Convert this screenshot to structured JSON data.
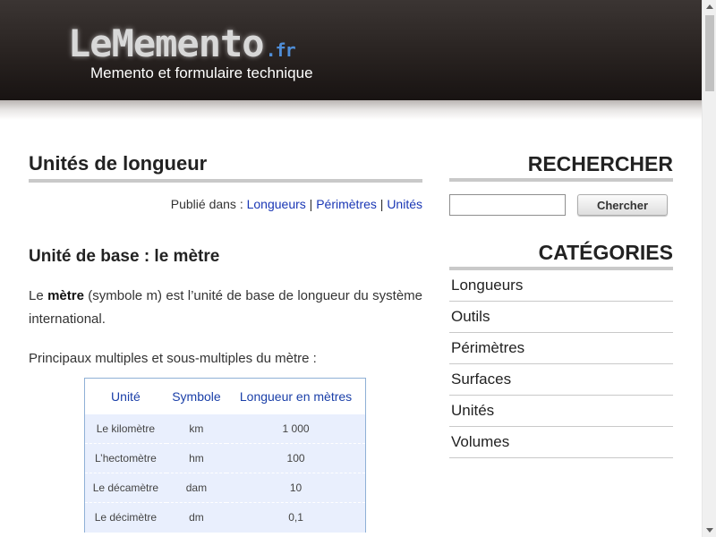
{
  "header": {
    "logo_main": "LeMemento",
    "logo_tld": ".fr",
    "tagline": "Memento et formulaire technique"
  },
  "article": {
    "title": "Unités de longueur",
    "published_prefix": "Publié dans :",
    "published_links": [
      "Longueurs",
      "Périmètres",
      "Unités"
    ],
    "section_title": "Unité de base : le mètre",
    "para1_before": "Le ",
    "para1_bold": "mètre",
    "para1_after": " (symbole m) est l’unité de base de longueur du système international.",
    "para2": "Principaux multiples et sous-multiples du mètre :",
    "table": {
      "headers": [
        "Unité",
        "Symbole",
        "Longueur en mètres"
      ],
      "rows": [
        [
          "Le kilomètre",
          "km",
          "1 000"
        ],
        [
          "L’hectomètre",
          "hm",
          "100"
        ],
        [
          "Le décamètre",
          "dam",
          "10"
        ],
        [
          "Le décimètre",
          "dm",
          "0,1"
        ]
      ]
    }
  },
  "sidebar": {
    "search_heading": "RECHERCHER",
    "search_value": "",
    "search_button": "Chercher",
    "categories_heading": "CATÉGORIES",
    "categories": [
      "Longueurs",
      "Outils",
      "Périmètres",
      "Surfaces",
      "Unités",
      "Volumes"
    ]
  }
}
